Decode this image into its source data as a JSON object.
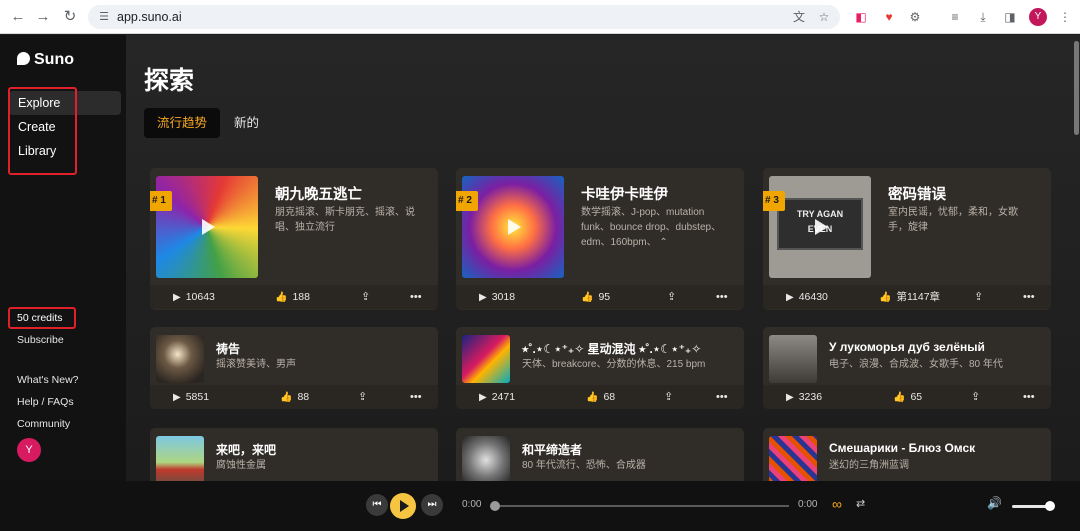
{
  "browser": {
    "url": "app.suno.ai",
    "profile_initial": "Y"
  },
  "sidebar": {
    "logo": "Suno",
    "items": [
      {
        "label": "Explore",
        "active": true
      },
      {
        "label": "Create",
        "active": false
      },
      {
        "label": "Library",
        "active": false
      }
    ],
    "credits": "50 credits",
    "subscribe": "Subscribe",
    "whats_new": "What's New?",
    "help": "Help / FAQs",
    "community": "Community",
    "avatar_initial": "Y"
  },
  "main": {
    "title": "探索",
    "tabs": [
      {
        "label": "流行趋势",
        "active": true
      },
      {
        "label": "新的",
        "active": false
      }
    ]
  },
  "songs": [
    {
      "rank": "# 1",
      "title": "朝九晚五逃亡",
      "tags_line1": "朋克摇滚、斯卡朋克、摇滚、说",
      "tags_line2": "唱、独立流行",
      "plays": "10643",
      "likes": "188"
    },
    {
      "rank": "# 2",
      "title": "卡哇伊卡哇伊",
      "tags_line1": "数学摇滚、J-pop、mutation",
      "tags_line2": "funk、bounce drop、dubstep、",
      "tags_line3": "edm、160bpm、",
      "expand_icon": "chevron-up",
      "plays": "3018",
      "likes": "95"
    },
    {
      "rank": "# 3",
      "title": "密码错误",
      "tags_line1": "室内民谣，忧郁，柔和，女歌",
      "tags_line2": "手，旋律",
      "plays": "46430",
      "likes": "第1147章",
      "thumb_text_1": "TRY AGAN",
      "thumb_text_2": "EVEN"
    },
    {
      "title": "祷告",
      "tags_line1": "摇滚赞美诗、男声",
      "plays": "5851",
      "likes": "88"
    },
    {
      "title": "⭒˚.⋆☾⋆⁺₊✧ 星动混沌 ⭒˚.⋆☾⋆⁺₊✧",
      "tags_line1": "天体、breakcore、分数的休息、215 bpm",
      "plays": "2471",
      "likes": "68"
    },
    {
      "title": "У лукоморья дуб зелёный",
      "tags_line1": "电子、浪漫、合成波、女歌手、80 年代",
      "plays": "3236",
      "likes": "65"
    },
    {
      "title": "来吧，来吧",
      "tags_line1": "腐蚀性金属"
    },
    {
      "title": "和平缔造者",
      "tags_line1": "80 年代流行、恐怖、合成器"
    },
    {
      "title": "Смешарики - Блюз Омск",
      "tags_line1": "迷幻的三角洲蓝调"
    }
  ],
  "player": {
    "current_time": "0:00",
    "total_time": "0:00"
  },
  "colors": {
    "accent": "#f5a623",
    "highlight_box": "#e0202a",
    "rank_badge": "#f0a500"
  }
}
